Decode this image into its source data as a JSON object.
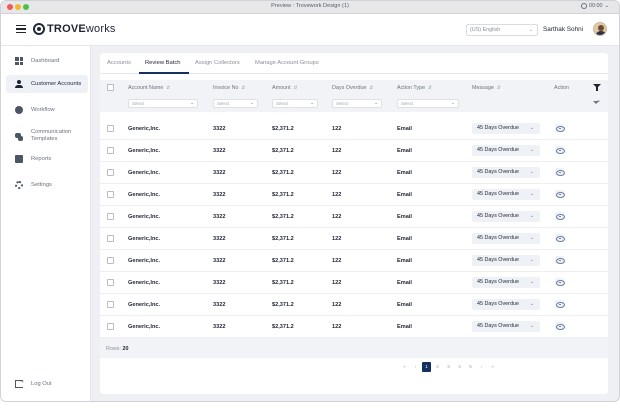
{
  "window": {
    "title": "Preview : Trovework Design (1)",
    "clock": "00:00"
  },
  "header": {
    "logo_bold": "TROVE",
    "logo_light": "works",
    "language": "(US) English",
    "user_name": "Sarthak Sohni"
  },
  "sidebar": {
    "items": [
      {
        "label": "Dashboard",
        "icon": "dashboard-icon"
      },
      {
        "label": "Customer Accounts",
        "icon": "user-icon",
        "active": true
      },
      {
        "label": "Workflow",
        "icon": "workflow-icon"
      },
      {
        "label": "Communication",
        "label2": "Templates",
        "icon": "chat-icon"
      },
      {
        "label": "Reports",
        "icon": "report-icon"
      },
      {
        "label": "Settings",
        "icon": "gear-icon"
      }
    ],
    "logout": "Log Out"
  },
  "tabs": [
    {
      "label": "Accounts"
    },
    {
      "label": "Review Batch",
      "active": true
    },
    {
      "label": "Assign Collectors"
    },
    {
      "label": "Manage Account Groups"
    }
  ],
  "table": {
    "columns": [
      "Account Name",
      "Invoice No",
      "Amount",
      "Days Overdue",
      "Action Type",
      "Message",
      "Action"
    ],
    "filter_placeholder": "Select",
    "rows": [
      {
        "account": "Generic,Inc.",
        "invoice": "3322",
        "amount": "$2,371.2",
        "days": "122",
        "action_type": "Email",
        "message": "45 Days Overdue"
      },
      {
        "account": "Generic,Inc.",
        "invoice": "3322",
        "amount": "$2,371.2",
        "days": "122",
        "action_type": "Email",
        "message": "45 Days Overdue"
      },
      {
        "account": "Generic,Inc.",
        "invoice": "3322",
        "amount": "$2,371.2",
        "days": "122",
        "action_type": "Email",
        "message": "45 Days Overdue"
      },
      {
        "account": "Generic,Inc.",
        "invoice": "3322",
        "amount": "$2,371.2",
        "days": "122",
        "action_type": "Email",
        "message": "45 Days Overdue"
      },
      {
        "account": "Generic,Inc.",
        "invoice": "3322",
        "amount": "$2,371.2",
        "days": "122",
        "action_type": "Email",
        "message": "45 Days Overdue"
      },
      {
        "account": "Generic,Inc.",
        "invoice": "3322",
        "amount": "$2,371.2",
        "days": "122",
        "action_type": "Email",
        "message": "45 Days Overdue"
      },
      {
        "account": "Generic,Inc.",
        "invoice": "3322",
        "amount": "$2,371.2",
        "days": "122",
        "action_type": "Email",
        "message": "45 Days Overdue"
      },
      {
        "account": "Generic,Inc.",
        "invoice": "3322",
        "amount": "$2,371.2",
        "days": "122",
        "action_type": "Email",
        "message": "45 Days Overdue"
      },
      {
        "account": "Generic,Inc.",
        "invoice": "3322",
        "amount": "$2,371.2",
        "days": "122",
        "action_type": "Email",
        "message": "45 Days Overdue"
      },
      {
        "account": "Generic,Inc.",
        "invoice": "3322",
        "amount": "$2,371.2",
        "days": "122",
        "action_type": "Email",
        "message": "45 Days Overdue"
      }
    ],
    "rows_label": "Rows:",
    "rows_count": "20"
  },
  "pagination": {
    "first": "«",
    "prev": "‹",
    "pages": [
      "1",
      "2",
      "3",
      "4",
      "5"
    ],
    "current": "1",
    "next": "›",
    "last": "»"
  }
}
